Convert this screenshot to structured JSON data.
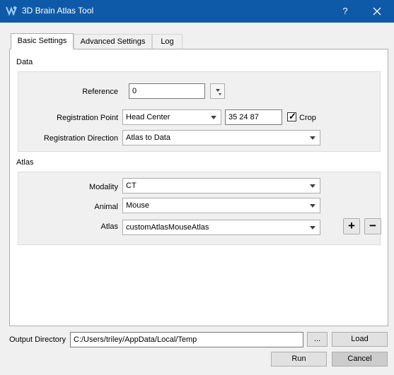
{
  "window": {
    "title": "3D Brain Atlas Tool",
    "help_label": "?",
    "title_bar_color": "#0f5aa8"
  },
  "tabs": [
    {
      "label": "Basic Settings",
      "active": true
    },
    {
      "label": "Advanced Settings",
      "active": false
    },
    {
      "label": "Log",
      "active": false
    }
  ],
  "data_section": {
    "heading": "Data",
    "reference": {
      "label": "Reference",
      "value": "0"
    },
    "registration_point": {
      "label": "Registration Point",
      "selected": "Head Center",
      "coords": "35 24 87"
    },
    "crop": {
      "label": "Crop",
      "checked": true,
      "check_glyph": "✓"
    },
    "registration_direction": {
      "label": "Registration Direction",
      "selected": "Atlas to Data"
    }
  },
  "atlas_section": {
    "heading": "Atlas",
    "modality": {
      "label": "Modality",
      "selected": "CT"
    },
    "animal": {
      "label": "Animal",
      "selected": "Mouse"
    },
    "atlas": {
      "label": "Atlas",
      "selected": "customAtlasMouseAtlas"
    },
    "add_label": "+",
    "remove_label": "−"
  },
  "footer": {
    "output_directory_label": "Output Directory",
    "output_directory_value": "C:/Users/triley/AppData/Local/Temp",
    "browse_label": "...",
    "load_label": "Load",
    "run_label": "Run",
    "cancel_label": "Cancel"
  }
}
